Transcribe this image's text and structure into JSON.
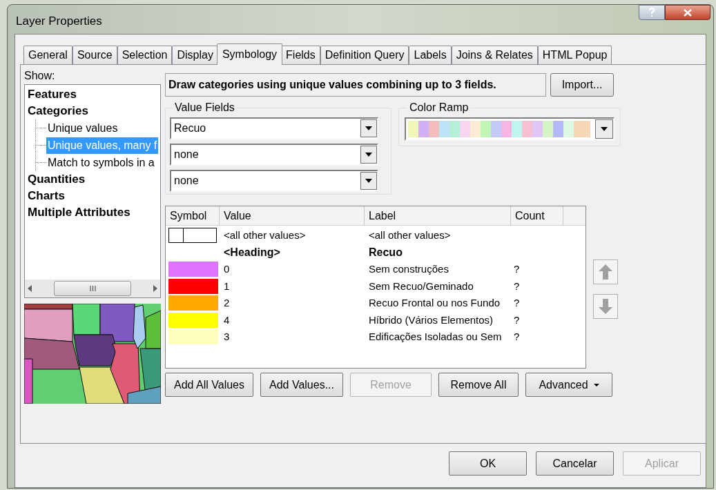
{
  "window": {
    "title": "Layer Properties"
  },
  "tabs": [
    {
      "label": "General",
      "selected": false
    },
    {
      "label": "Source",
      "selected": false
    },
    {
      "label": "Selection",
      "selected": false
    },
    {
      "label": "Display",
      "selected": false
    },
    {
      "label": "Symbology",
      "selected": true
    },
    {
      "label": "Fields",
      "selected": false
    },
    {
      "label": "Definition Query",
      "selected": false
    },
    {
      "label": "Labels",
      "selected": false
    },
    {
      "label": "Joins & Relates",
      "selected": false
    },
    {
      "label": "HTML Popup",
      "selected": false
    }
  ],
  "show": {
    "label": "Show:",
    "items": [
      {
        "label": "Features",
        "selected": false
      },
      {
        "label": "Categories",
        "selected": false,
        "children": [
          {
            "label": "Unique values",
            "selected": false
          },
          {
            "label": "Unique values, many f",
            "selected": true
          },
          {
            "label": "Match to symbols in a",
            "selected": false
          }
        ]
      },
      {
        "label": "Quantities",
        "selected": false
      },
      {
        "label": "Charts",
        "selected": false
      },
      {
        "label": "Multiple Attributes",
        "selected": false
      }
    ]
  },
  "description": "Draw categories using unique values combining up to 3 fields.",
  "import_button": "Import...",
  "value_fields": {
    "title": "Value Fields",
    "fields": [
      {
        "value": "Recuo"
      },
      {
        "value": "none"
      },
      {
        "value": "none"
      }
    ]
  },
  "color_ramp": {
    "title": "Color Ramp"
  },
  "table": {
    "columns": [
      "Symbol",
      "Value",
      "Label",
      "Count"
    ],
    "rows": [
      {
        "kind": "other",
        "value": "<all other values>",
        "label": "<all other values>"
      },
      {
        "kind": "heading",
        "value": "<Heading>",
        "label": "Recuo"
      },
      {
        "kind": "value",
        "color": "#df73ff",
        "value": "0",
        "label": "Sem construções",
        "count": "?"
      },
      {
        "kind": "value",
        "color": "#ff0000",
        "value": "1",
        "label": "Sem Recuo/Geminado",
        "count": "?"
      },
      {
        "kind": "value",
        "color": "#ffaa00",
        "value": "2",
        "label": "Recuo Frontal ou nos Fundo",
        "count": "?"
      },
      {
        "kind": "value",
        "color": "#ffff00",
        "value": "4",
        "label": "Híbrido (Vários Elementos)",
        "count": "?"
      },
      {
        "kind": "value",
        "color": "#ffffbe",
        "value": "3",
        "label": "Edificações Isoladas ou Sem",
        "count": "?"
      }
    ]
  },
  "actions": [
    {
      "label": "Add All Values",
      "disabled": false
    },
    {
      "label": "Add Values...",
      "disabled": false
    },
    {
      "label": "Remove",
      "disabled": true
    },
    {
      "label": "Remove All",
      "disabled": false
    },
    {
      "label": "Advanced",
      "disabled": false,
      "menu": true
    }
  ],
  "footer": [
    {
      "label": "OK",
      "disabled": false
    },
    {
      "label": "Cancelar",
      "disabled": false
    },
    {
      "label": "Aplicar",
      "disabled": true
    }
  ]
}
